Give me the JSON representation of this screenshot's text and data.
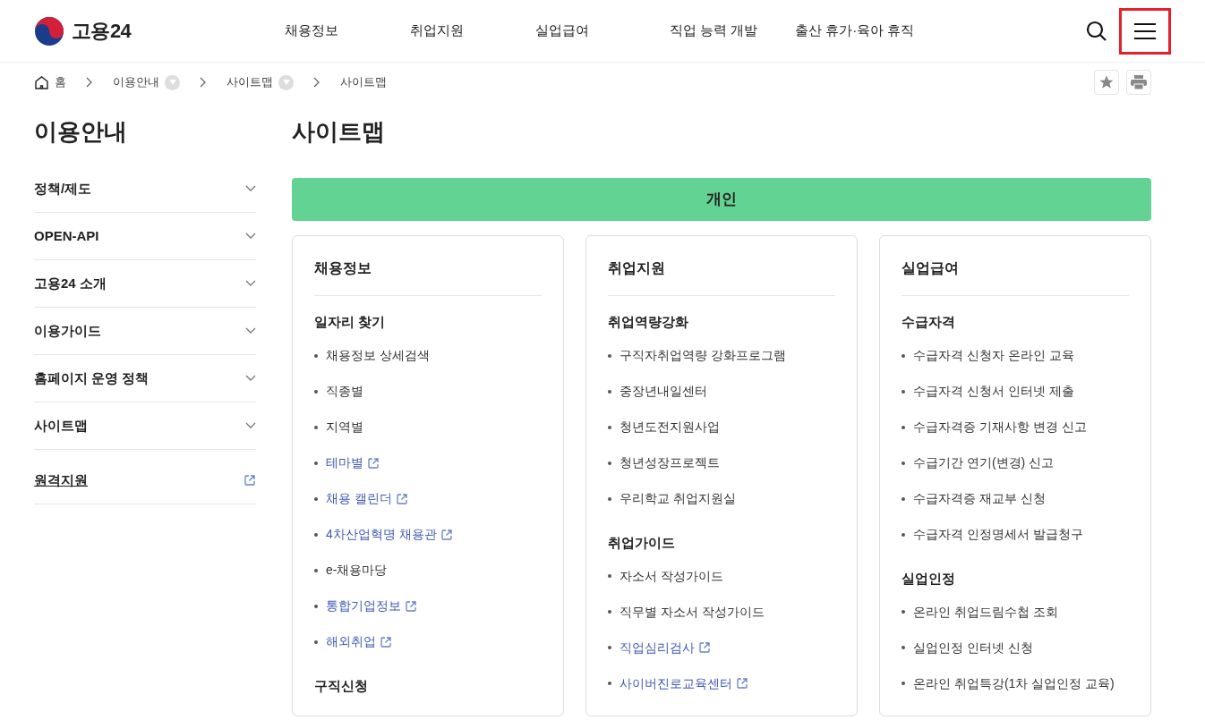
{
  "header": {
    "logo_text": "고용24",
    "nav": [
      "채용정보",
      "취업지원",
      "실업급여",
      "직업 능력 개발",
      "출산 휴가·육아 휴직"
    ],
    "menu_highlighted": true
  },
  "breadcrumb": [
    {
      "label": "홈",
      "kind": "home"
    },
    {
      "label": "이용안내",
      "kind": "dropdown"
    },
    {
      "label": "사이트맵",
      "kind": "dropdown"
    },
    {
      "label": "사이트맵",
      "kind": "current"
    }
  ],
  "sidebar": {
    "title": "이용안내",
    "items": [
      {
        "label": "정책/제도",
        "kind": "menu"
      },
      {
        "label": "OPEN-API",
        "kind": "menu"
      },
      {
        "label": "고용24 소개",
        "kind": "menu"
      },
      {
        "label": "이용가이드",
        "kind": "menu"
      },
      {
        "label": "홈페이지 운영 정책",
        "kind": "menu"
      },
      {
        "label": "사이트맵",
        "kind": "menu"
      },
      {
        "label": "원격지원",
        "kind": "external"
      }
    ]
  },
  "page_title": "사이트맵",
  "section_banner": "개인",
  "columns": [
    {
      "title": "채용정보",
      "groups": [
        {
          "heading": "일자리 찾기",
          "items": [
            {
              "label": "채용정보 상세검색",
              "kind": "plain"
            },
            {
              "label": "직종별",
              "kind": "plain"
            },
            {
              "label": "지역별",
              "kind": "plain"
            },
            {
              "label": "테마별",
              "kind": "external"
            },
            {
              "label": "채용 캘린더",
              "kind": "external"
            },
            {
              "label": "4차산업혁명 채용관",
              "kind": "external"
            },
            {
              "label": "e-채용마당",
              "kind": "plain"
            },
            {
              "label": "통합기업정보",
              "kind": "external"
            },
            {
              "label": "해외취업",
              "kind": "external"
            }
          ]
        },
        {
          "heading": "구직신청"
        }
      ]
    },
    {
      "title": "취업지원",
      "groups": [
        {
          "heading": "취업역량강화",
          "items": [
            {
              "label": "구직자취업역량 강화프로그램",
              "kind": "plain"
            },
            {
              "label": "중장년내일센터",
              "kind": "plain"
            },
            {
              "label": "청년도전지원사업",
              "kind": "plain"
            },
            {
              "label": "청년성장프로젝트",
              "kind": "plain"
            },
            {
              "label": "우리학교 취업지원실",
              "kind": "plain"
            }
          ]
        },
        {
          "heading": "취업가이드",
          "items": [
            {
              "label": "자소서 작성가이드",
              "kind": "plain"
            },
            {
              "label": "직무별 자소서 작성가이드",
              "kind": "plain"
            },
            {
              "label": "직업심리검사",
              "kind": "external"
            },
            {
              "label": "사이버진로교육센터",
              "kind": "external"
            }
          ]
        }
      ]
    },
    {
      "title": "실업급여",
      "groups": [
        {
          "heading": "수급자격",
          "items": [
            {
              "label": "수급자격 신청자 온라인 교육",
              "kind": "plain"
            },
            {
              "label": "수급자격 신청서 인터넷 제출",
              "kind": "plain"
            },
            {
              "label": "수급자격증 기재사항 변경 신고",
              "kind": "plain"
            },
            {
              "label": "수급기간 연기(변경) 신고",
              "kind": "plain"
            },
            {
              "label": "수급자격증 재교부 신청",
              "kind": "plain"
            },
            {
              "label": "수급자격 인정명세서 발급청구",
              "kind": "plain"
            }
          ]
        },
        {
          "heading": "실업인정",
          "items": [
            {
              "label": "온라인 취업드림수첩 조회",
              "kind": "plain"
            },
            {
              "label": "실업인정 인터넷 신청",
              "kind": "plain"
            },
            {
              "label": "온라인 취업특강(1차 실업인정 교육)",
              "kind": "plain"
            }
          ]
        }
      ]
    }
  ]
}
